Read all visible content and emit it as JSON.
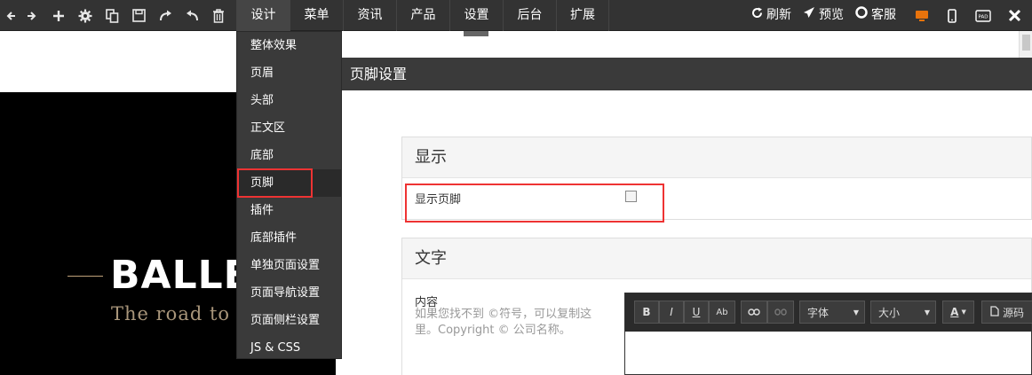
{
  "toolbar": {
    "icons": [
      "back-arrow-icon",
      "forward-arrow-icon",
      "plus-icon",
      "gear-icon",
      "copy-icon",
      "save-icon",
      "redo-icon",
      "undo-icon",
      "trash-icon"
    ],
    "menu": [
      {
        "label": "设计",
        "active": true
      },
      {
        "label": "菜单"
      },
      {
        "label": "资讯"
      },
      {
        "label": "产品"
      },
      {
        "label": "设置"
      },
      {
        "label": "后台"
      },
      {
        "label": "扩展"
      }
    ],
    "refresh_label": "刷新",
    "preview_label": "预览",
    "support_label": "客服",
    "devices": [
      "desktop-icon",
      "mobile-icon",
      "pad-icon"
    ],
    "pad_label": "PAD",
    "accent_color": "#e8730c"
  },
  "dropdown": {
    "items": [
      "整体效果",
      "页眉",
      "头部",
      "正文区",
      "底部",
      "页脚",
      "插件",
      "底部插件",
      "单独页面设置",
      "页面导航设置",
      "页面侧栏设置",
      "JS & CSS"
    ],
    "selected_index": 5
  },
  "preview": {
    "brand_text": "BALLE",
    "brand_subtitle": "The road to b"
  },
  "panel": {
    "title": "页脚设置",
    "display_section": {
      "heading": "显示",
      "field_label": "显示页脚",
      "checked": false
    },
    "text_section": {
      "heading": "文字",
      "field_label": "内容",
      "hint": "如果您找不到 ©符号，可以复制这里。Copyright © 公司名称。",
      "hint_line1": "如果您找不到 ©符号，可以复制这",
      "hint_line2": "里。Copyright © 公司名称。"
    },
    "editor": {
      "bold": "B",
      "italic": "I",
      "underline": "U",
      "strike": "Ab",
      "font_label": "字体",
      "size_label": "大小",
      "color_label": "A",
      "source_label": "源码"
    }
  },
  "highlight_color": "#e33333"
}
